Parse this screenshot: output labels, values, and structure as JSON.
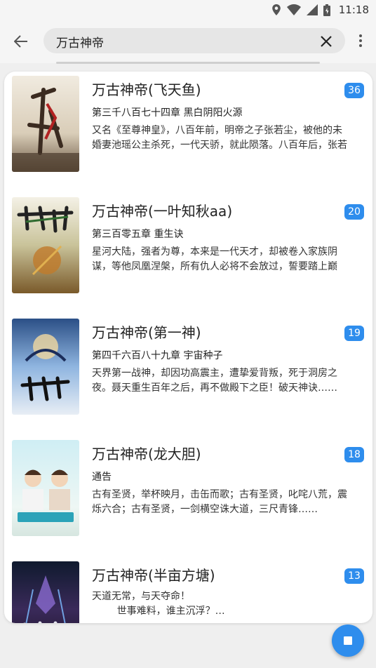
{
  "status_bar": {
    "time": "11:18",
    "icons": [
      "location-icon",
      "wifi-icon",
      "signal-icon",
      "battery-icon"
    ]
  },
  "app_bar": {
    "search_query": "万古神帝",
    "back_icon": "arrow-left-icon",
    "clear_icon": "close-icon",
    "more_icon": "more-vertical-icon"
  },
  "results": [
    {
      "title": "万古神帝(飞天鱼)",
      "latest_chapter": "第三千八百七十四章 黑白阴阳火源",
      "intro": "又名《至尊神皇》，八百年前，明帝之子张若尘，被他的未婚妻池瑶公主杀死，一代天骄，就此陨落。八百年后，张若尘重新活了过来……",
      "badge": "36"
    },
    {
      "title": "万古神帝(一叶知秋aa)",
      "latest_chapter": "第三百零五章 重生诀",
      "intro": "星河大陆，强者为尊，本来是一代天才，却被卷入家族阴谋，等他凤凰涅槃，所有仇人必将不会放过，誓要踏上巅峰……",
      "badge": "20"
    },
    {
      "title": "万古神帝(第一神)",
      "latest_chapter": "第四千六百八十九章 宇宙种子",
      "intro": "天界第一战神，却因功高震主，遭挚爱背叛，死于洞房之夜。聂天重生百年之后，再不做殿下之臣！破天神诀……",
      "badge": "19"
    },
    {
      "title": "万古神帝(龙大胆)",
      "latest_chapter": "通告",
      "intro": "古有圣贤，举杯映月，击缶而歌；古有圣贤，叱咤八荒，震烁六合；古有圣贤，一剑横空诛大道，三尺青锋……",
      "badge": "18"
    },
    {
      "title": "万古神帝(半亩方塘)",
      "latest_chapter": "",
      "intro": "天道无常，与天夺命！\n        世事难料，谁主沉浮？…",
      "badge": "13"
    }
  ],
  "colors": {
    "accent": "#2e8ded",
    "card_bg": "#ffffff",
    "page_bg": "#efefef"
  },
  "fab": {
    "icon": "stop-icon"
  }
}
